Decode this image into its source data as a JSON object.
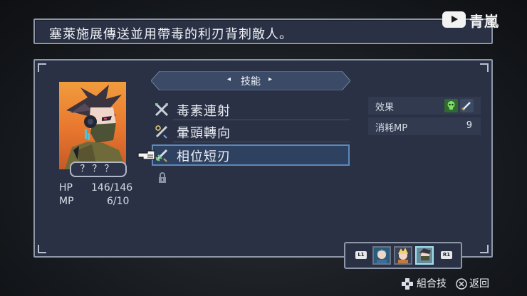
{
  "description": "塞萊施展傳送並用帶毒的利刃背刺敵人。",
  "watermark": {
    "icon": "youtube-icon",
    "name": "青嵐"
  },
  "character": {
    "name": "？？？",
    "hp_label": "HP",
    "hp_value": "146/146",
    "mp_label": "MP",
    "mp_value": "6/10"
  },
  "tab": {
    "label": "技能",
    "left_arrow": "◂",
    "right_arrow": "▸"
  },
  "skills": [
    {
      "name": "毒素連射",
      "icon": "crossed-blades-icon"
    },
    {
      "name": "暈頭轉向",
      "icon": "dizzy-blade-icon"
    },
    {
      "name": "相位短刃",
      "icon": "phase-dagger-icon",
      "selected": true
    }
  ],
  "effects": {
    "effect_label": "效果",
    "cost_label": "消耗MP",
    "cost_value": "9",
    "effect_icons": [
      "poison-skull-icon",
      "dagger-icon"
    ]
  },
  "party": {
    "left_button": "L1",
    "right_button": "R1",
    "selected_index": 2
  },
  "hints": [
    {
      "icon": "dpad-icon",
      "label": "組合技"
    },
    {
      "icon": "circle-button-icon",
      "label": "返回"
    }
  ],
  "colors": {
    "panel": "#2a3145",
    "border": "#8d97a8",
    "selection": "#5e88b8",
    "portrait_bg": "#e8762e"
  }
}
